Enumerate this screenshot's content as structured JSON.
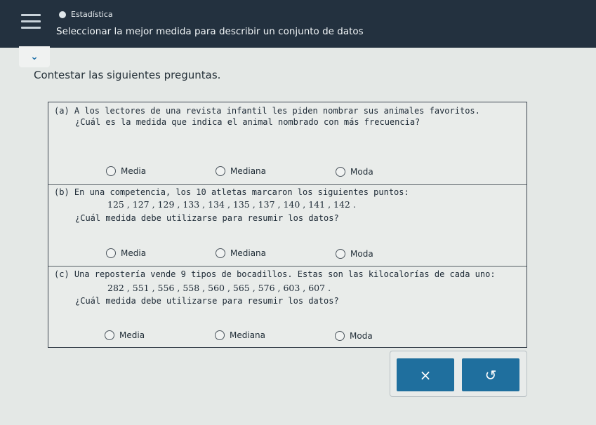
{
  "header": {
    "topic": "Estadística",
    "title": "Seleccionar la mejor medida para describir un conjunto de datos"
  },
  "instructions": "Contestar las siguientes preguntas.",
  "questions": [
    {
      "line1": "(a) A los lectores de una revista infantil les piden nombrar sus animales favoritos.",
      "line2": "¿Cuál es la medida que indica el animal nombrado con más frecuencia?",
      "options": [
        "Media",
        "Mediana",
        "Moda"
      ]
    },
    {
      "line1": "(b) En una competencia, los 10 atletas marcaron los siguientes puntos:",
      "data": "125 , 127 , 129 , 133 , 134 , 135 , 137 , 140 , 141 , 142 .",
      "line2": "¿Cuál medida debe utilizarse para resumir los datos?",
      "options": [
        "Media",
        "Mediana",
        "Moda"
      ]
    },
    {
      "line1": "(c) Una repostería vende 9 tipos de bocadillos. Estas son las kilocalorías de cada uno:",
      "data": "282 , 551 , 556 , 558 , 560 , 565 , 576 , 603 , 607 .",
      "line2": "¿Cuál medida debe utilizarse para resumir los datos?",
      "options": [
        "Media",
        "Mediana",
        "Moda"
      ]
    }
  ],
  "actions": {
    "clear_glyph": "×",
    "undo_glyph": "↺"
  },
  "icons": {
    "menu": "menu-icon",
    "topic": "topic-dot-icon",
    "collapse": "chevron-down-icon",
    "clear": "close-icon",
    "undo": "undo-icon"
  },
  "colors": {
    "header_bg": "#23313f",
    "button_bg": "#1f6f9e",
    "link_blue": "#1e6fa8"
  }
}
